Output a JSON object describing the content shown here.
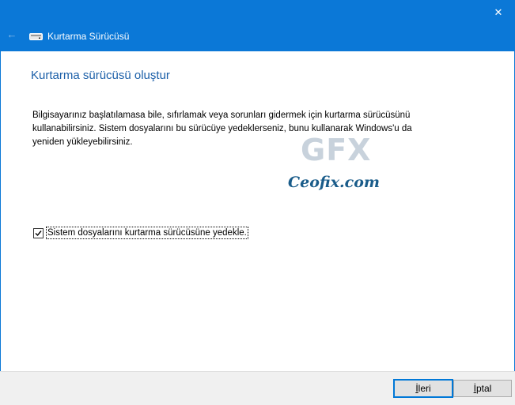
{
  "window": {
    "title": "Kurtarma Sürücüsü",
    "close_glyph": "✕",
    "back_glyph": "←",
    "accent_color": "#0b78d7",
    "app_icon": "drive-icon"
  },
  "page": {
    "heading": "Kurtarma sürücüsü oluştur",
    "description_lines": [
      "Bilgisayarınız başlatılamasa bile, sıfırlamak veya sorunları gidermek için kurtarma sürücüsünü",
      "kullanabilirsiniz. Sistem dosyalarını bu sürücüye yedeklerseniz, bunu kullanarak Windows'u da",
      "yeniden yükleyebilirsiniz."
    ]
  },
  "watermark": {
    "logo": "GFX",
    "text": "Ceofix.com"
  },
  "options": {
    "backup_checkbox": {
      "label": "Sistem dosyalarını kurtarma sürücüsüne yedekle.",
      "checked": true
    }
  },
  "buttons": {
    "next_first": "İ",
    "next_rest": "leri",
    "cancel_first": "İ",
    "cancel_rest": "ptal"
  }
}
